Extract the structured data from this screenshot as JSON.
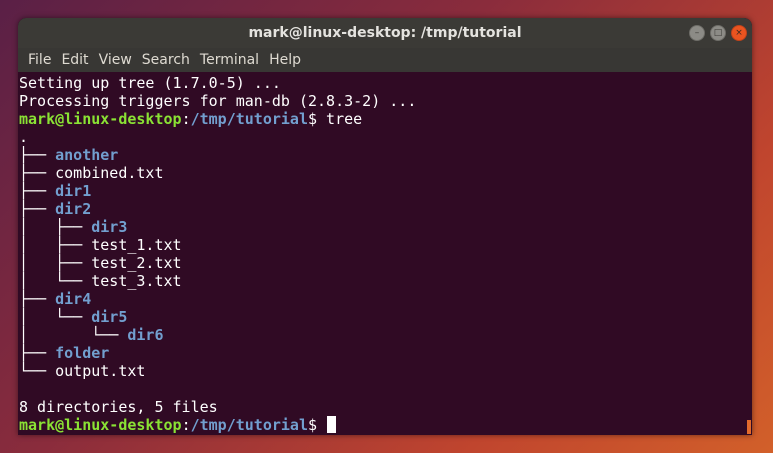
{
  "window": {
    "title": "mark@linux-desktop: /tmp/tutorial",
    "buttons": {
      "minimize": "–",
      "maximize": "□",
      "close": "×"
    }
  },
  "menubar": {
    "items": [
      "File",
      "Edit",
      "View",
      "Search",
      "Terminal",
      "Help"
    ]
  },
  "terminal": {
    "prompt_user": "mark@linux-desktop",
    "prompt_sep": ":",
    "prompt_path": "/tmp/tutorial",
    "prompt_end": "$",
    "lines": {
      "l0": "Setting up tree (1.7.0-5) ...",
      "l1": "Processing triggers for man-db (2.8.3-2) ...",
      "l2_cmd": " tree",
      "l3": ".",
      "l4_pre": "├── ",
      "l4_name": "another",
      "l5_pre": "├── ",
      "l5_name": "combined.txt",
      "l6_pre": "├── ",
      "l6_name": "dir1",
      "l7_pre": "├── ",
      "l7_name": "dir2",
      "l8_pre": "│   ├── ",
      "l8_name": "dir3",
      "l9_pre": "│   ├── ",
      "l9_name": "test_1.txt",
      "l10_pre": "│   ├── ",
      "l10_name": "test_2.txt",
      "l11_pre": "│   └── ",
      "l11_name": "test_3.txt",
      "l12_pre": "├── ",
      "l12_name": "dir4",
      "l13_pre": "│   └── ",
      "l13_name": "dir5",
      "l14_pre": "│       └── ",
      "l14_name": "dir6",
      "l15_pre": "├── ",
      "l15_name": "folder",
      "l16_pre": "└── ",
      "l16_name": "output.txt",
      "l17": "",
      "l18": "8 directories, 5 files",
      "l19_cmd": " "
    }
  },
  "colors": {
    "background": "#300a24",
    "prompt_user": "#8ae234",
    "directory": "#729fcf",
    "text": "#ffffff",
    "accent": "#e95420"
  }
}
